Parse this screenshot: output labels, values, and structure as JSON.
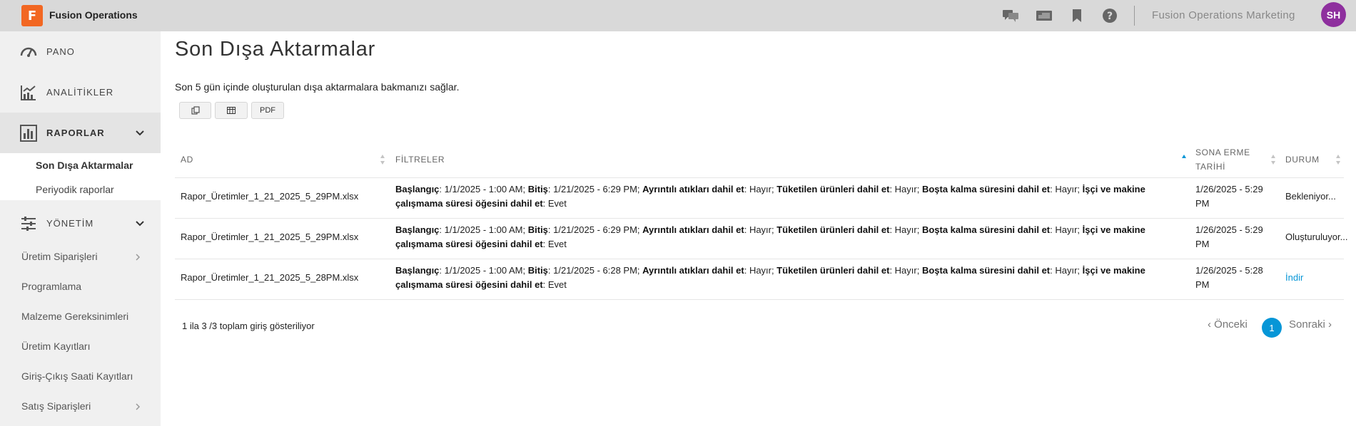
{
  "app": {
    "logo_letter": "F",
    "title": "Fusion Operations",
    "org_name": "Fusion Operations Marketing",
    "user_initials": "SH",
    "accent_color": "#0696d7",
    "brand_color": "#f26722",
    "avatar_color": "#8e2f9e"
  },
  "topbar": {
    "icons": [
      "chat-icon",
      "presentation-icon",
      "bookmark-icon",
      "help-icon"
    ]
  },
  "sidebar": {
    "items": [
      {
        "label": "PANO",
        "icon": "dashboard-icon"
      },
      {
        "label": "ANALİTİKLER",
        "icon": "analytics-icon"
      },
      {
        "label": "RAPORLAR",
        "icon": "reports-icon"
      },
      {
        "label": "YÖNETİM",
        "icon": "sliders-icon"
      }
    ],
    "report_sub": [
      "Son Dışa Aktarmalar",
      "Periyodik raporlar"
    ],
    "management_sub": [
      {
        "label": "Üretim Siparişleri",
        "has_children": true
      },
      {
        "label": "Programlama",
        "has_children": false
      },
      {
        "label": "Malzeme Gereksinimleri",
        "has_children": false
      },
      {
        "label": "Üretim Kayıtları",
        "has_children": false
      },
      {
        "label": "Giriş-Çıkış Saati Kayıtları",
        "has_children": false
      },
      {
        "label": "Satış Siparişleri",
        "has_children": true
      }
    ]
  },
  "main": {
    "title": "Son Dışa Aktarmalar",
    "description": "Son 5 gün içinde oluşturulan dışa aktarmalara bakmanızı sağlar.",
    "buttons": {
      "copy_icon": "copy-icon",
      "csv_icon": "table-icon",
      "pdf": "PDF"
    }
  },
  "table": {
    "headers": {
      "name": "AD",
      "filters": "FİLTRELER",
      "expiry_line1": "SONA ERME",
      "expiry_line2": "TARİHİ",
      "status": "DURUM"
    },
    "filter_labels": {
      "start": "Başlangıç",
      "end": "Bitiş",
      "detailed_waste": "Ayrıntılı atıkları dahil et",
      "consumed": "Tüketilen ürünleri dahil et",
      "idle": "Boşta kalma süresini dahil et",
      "labor_line1": "İşçi ve makine",
      "labor_line2": "çalışmama süresi öğesini dahil et"
    },
    "rows": [
      {
        "name": "Rapor_Üretimler_1_21_2025_5_29PM.xlsx",
        "start_val": ": 1/1/2025 - 1:00 AM; ",
        "end_val": ": 1/21/2025 - 6:29 PM; ",
        "waste_val": ": Hayır; ",
        "consumed_val": ": Hayır; ",
        "idle_val": ": Hayır; ",
        "labor_val": ": Evet",
        "expiry_line1": "1/26/2025 - 5:29",
        "expiry_line2": "PM",
        "status": "Bekleniyor..."
      },
      {
        "name": "Rapor_Üretimler_1_21_2025_5_29PM.xlsx",
        "start_val": ": 1/1/2025 - 1:00 AM; ",
        "end_val": ": 1/21/2025 - 6:29 PM; ",
        "waste_val": ": Hayır; ",
        "consumed_val": ": Hayır; ",
        "idle_val": ": Hayır; ",
        "labor_val": ": Evet",
        "expiry_line1": "1/26/2025 - 5:29",
        "expiry_line2": "PM",
        "status": "Oluşturuluyor..."
      },
      {
        "name": "Rapor_Üretimler_1_21_2025_5_28PM.xlsx",
        "start_val": ": 1/1/2025 - 1:00 AM; ",
        "end_val": ": 1/21/2025 - 6:28 PM; ",
        "waste_val": ": Hayır; ",
        "consumed_val": ": Hayır; ",
        "idle_val": ": Hayır; ",
        "labor_val": ": Evet",
        "expiry_line1": "1/26/2025 - 5:28",
        "expiry_line2": "PM",
        "status": "İndir"
      }
    ],
    "sorted_column": "SONA ERME TARİHİ"
  },
  "footer": {
    "info": "1 ila 3 /3 toplam giriş gösteriliyor",
    "prev": "Önceki",
    "next": "Sonraki",
    "current_page": "1"
  }
}
